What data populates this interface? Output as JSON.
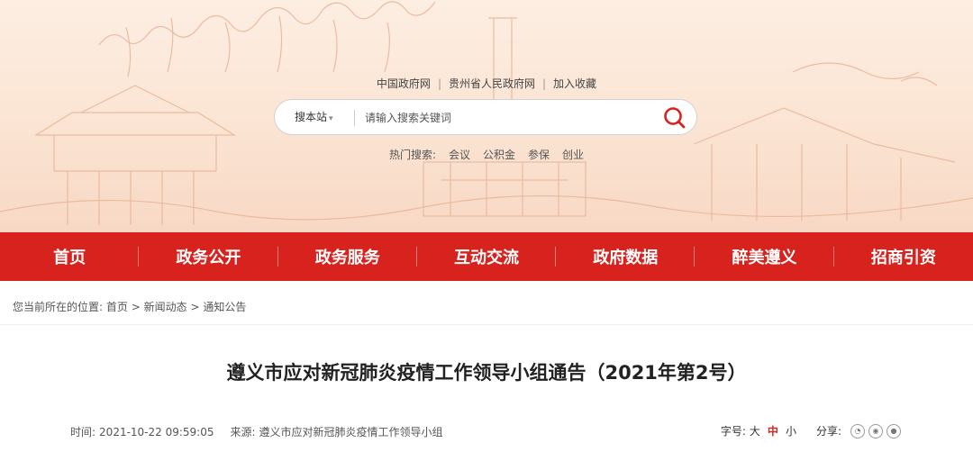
{
  "header": {
    "top_links": [
      "中国政府网",
      "贵州省人民政府网",
      "加入收藏"
    ],
    "separator": "|"
  },
  "search": {
    "scope_label": "搜本站",
    "placeholder": "请输入搜索关键词"
  },
  "hot_search": {
    "label": "热门搜索:",
    "keywords": [
      "会议",
      "公积金",
      "参保",
      "创业"
    ]
  },
  "nav": {
    "items": [
      "首页",
      "政务公开",
      "政务服务",
      "互动交流",
      "政府数据",
      "醉美遵义",
      "招商引资"
    ]
  },
  "breadcrumb": {
    "prefix": "您当前所在的位置:",
    "items": [
      "首页",
      "新闻动态",
      "通知公告"
    ],
    "separator": ">"
  },
  "article": {
    "title": "遵义市应对新冠肺炎疫情工作领导小组通告（2021年第2号）",
    "time_label": "时间:",
    "time_value": "2021-10-22 09:59:05",
    "source_label": "来源:",
    "source_value": "遵义市应对新冠肺炎疫情工作领导小组"
  },
  "tools": {
    "font_label": "字号:",
    "font_sizes": [
      "大",
      "中",
      "小"
    ],
    "active_font": "中",
    "share_label": "分享:"
  },
  "colors": {
    "accent": "#d7221d",
    "banner": "#fbe4d3"
  }
}
